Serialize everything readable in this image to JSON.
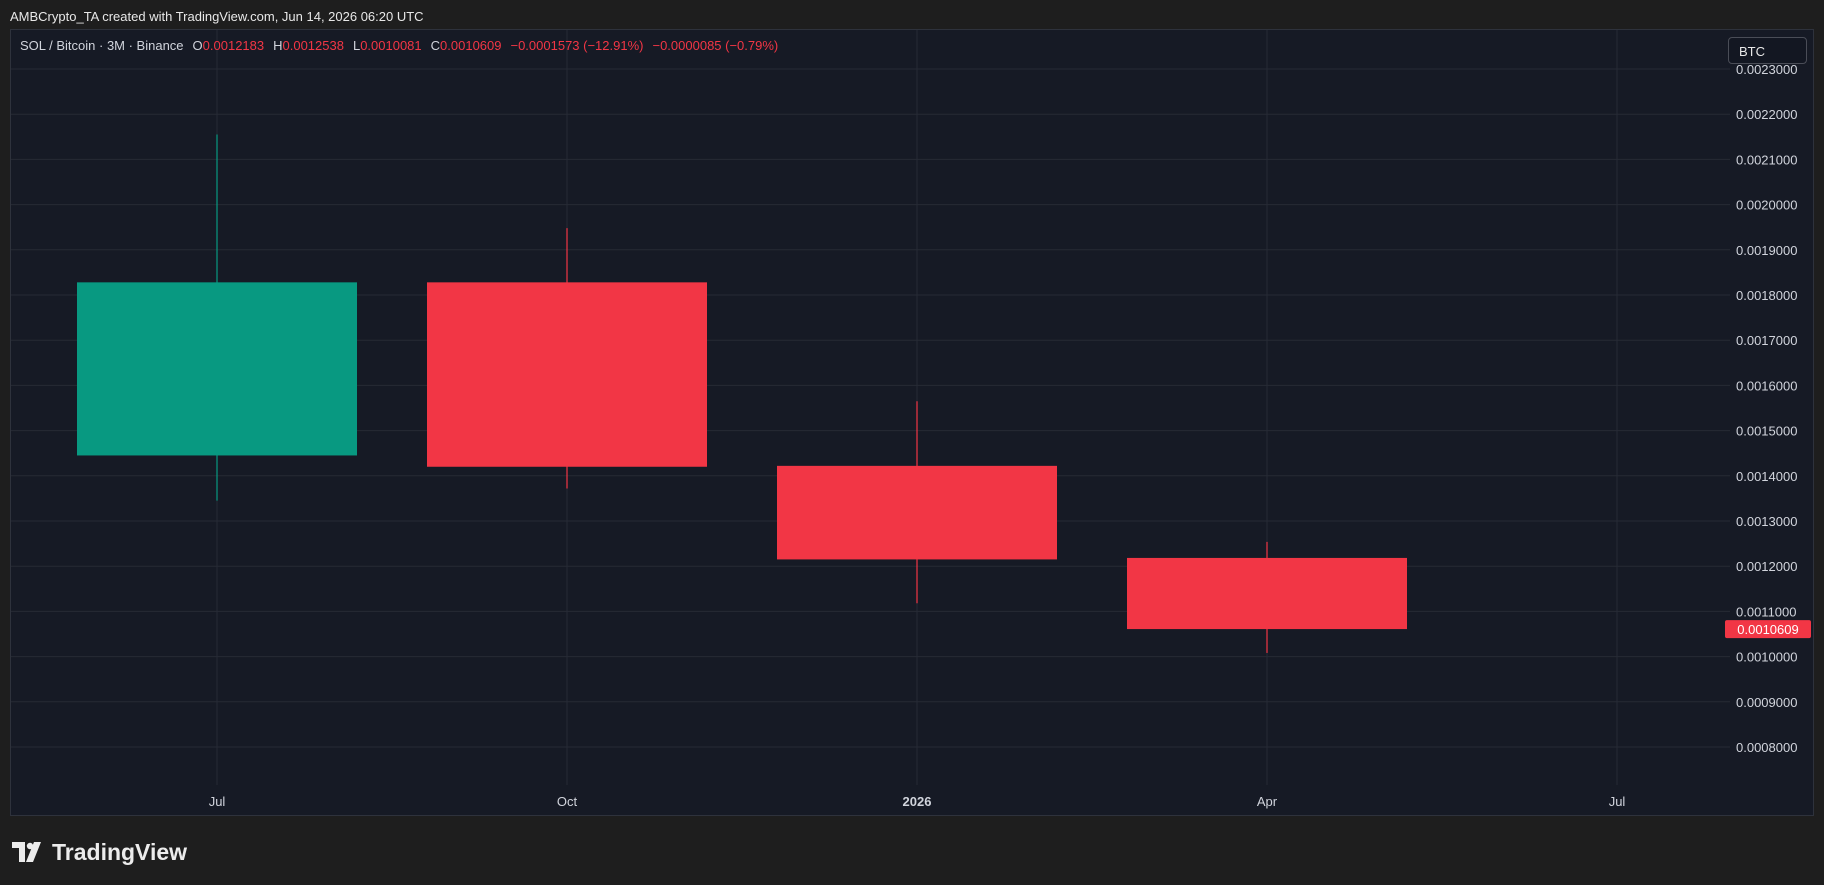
{
  "header": {
    "attribution": "AMBCrypto_TA created with TradingView.com, Jun 14, 2026 06:20 UTC"
  },
  "legend": {
    "symbol": "SOL / Bitcoin · 3M · Binance",
    "open_label": "O",
    "open_value": "0.0012183",
    "high_label": "H",
    "high_value": "0.0012538",
    "low_label": "L",
    "low_value": "0.0010081",
    "close_label": "C",
    "close_value": "0.0010609",
    "change": "−0.0001573 (−12.91%)",
    "change2": "−0.0000085 (−0.79%)"
  },
  "currency_button": "BTC",
  "last_price_label": "0.0010609",
  "brand": "TradingView",
  "colors": {
    "background": "#161a25",
    "up": "#089981",
    "down": "#f23645",
    "grid": "#262a35",
    "text": "#d1d4dc"
  },
  "chart_data": {
    "type": "candlestick",
    "x_ticks": [
      {
        "label": "Jul",
        "slot": 0,
        "bold": false
      },
      {
        "label": "Oct",
        "slot": 1,
        "bold": false
      },
      {
        "label": "2026",
        "slot": 2,
        "bold": true
      },
      {
        "label": "Apr",
        "slot": 3,
        "bold": false
      },
      {
        "label": "Jul",
        "slot": 4,
        "bold": false
      }
    ],
    "y_ticks": [
      "0.0023000",
      "0.0022000",
      "0.0021000",
      "0.0020000",
      "0.0019000",
      "0.0018000",
      "0.0017000",
      "0.0016000",
      "0.0015000",
      "0.0014000",
      "0.0013000",
      "0.0012000",
      "0.0011000",
      "0.0010000",
      "0.0009000",
      "0.0008000"
    ],
    "ylim": [
      0.00073,
      0.00236
    ],
    "candles": [
      {
        "period": "Jul",
        "open": 0.001445,
        "high": 0.002155,
        "low": 0.001345,
        "close": 0.001828
      },
      {
        "period": "Oct",
        "open": 0.001828,
        "high": 0.001948,
        "low": 0.001372,
        "close": 0.00142
      },
      {
        "period": "2026",
        "open": 0.001422,
        "high": 0.001565,
        "low": 0.001118,
        "close": 0.001215
      },
      {
        "period": "Apr",
        "open": 0.0012183,
        "high": 0.0012538,
        "low": 0.0010081,
        "close": 0.0010609
      }
    ],
    "last_price": 0.0010609
  }
}
